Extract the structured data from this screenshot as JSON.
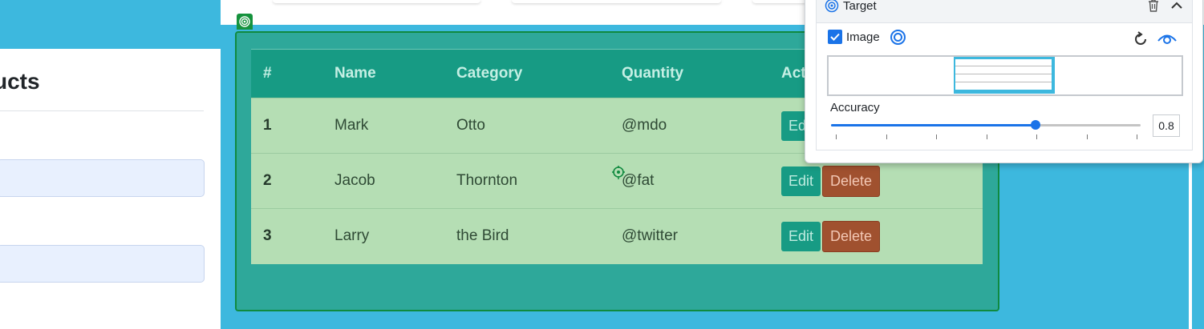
{
  "form": {
    "title": "ucts"
  },
  "table": {
    "headers": [
      "#",
      "Name",
      "Category",
      "Quantity",
      "Activ"
    ],
    "rows": [
      {
        "num": "1",
        "name": "Mark",
        "category": "Otto",
        "quantity": "@mdo",
        "edit": "Edit",
        "delete": ""
      },
      {
        "num": "2",
        "name": "Jacob",
        "category": "Thornton",
        "quantity": "@fat",
        "edit": "Edit",
        "delete": "Delete"
      },
      {
        "num": "3",
        "name": "Larry",
        "category": "the Bird",
        "quantity": "@twitter",
        "edit": "Edit",
        "delete": "Delete"
      }
    ]
  },
  "panel": {
    "title": "Target",
    "image_label": "Image",
    "image_checked": true,
    "accuracy_label": "Accuracy",
    "accuracy_value": "0.8",
    "slider_fraction": 0.66
  },
  "icons": {
    "panel_header": "target-icon",
    "delete": "trash-icon",
    "collapse": "chevron-up-icon",
    "refresh": "refresh-icon",
    "preview": "eye-icon",
    "selection": "target-icon",
    "cursor": "crosshair-icon"
  },
  "colors": {
    "page_bg": "#3db8de",
    "table_header": "#179b84",
    "table_row": "#b5deb4",
    "edit_button": "#179b84",
    "delete_button": "#a0512f",
    "accent": "#1a73e8"
  }
}
